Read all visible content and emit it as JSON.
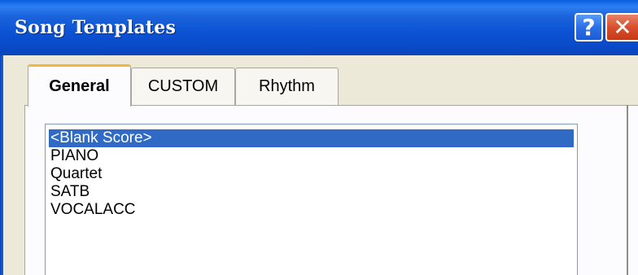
{
  "window": {
    "title": "Song Templates",
    "help_label": "?",
    "close_label": "✕"
  },
  "tabs": [
    {
      "label": "General",
      "selected": true
    },
    {
      "label": "CUSTOM",
      "selected": false
    },
    {
      "label": "Rhythm",
      "selected": false
    }
  ],
  "template_list": {
    "items": [
      {
        "label": "<Blank Score>",
        "selected": true
      },
      {
        "label": "PIANO",
        "selected": false
      },
      {
        "label": "Quartet",
        "selected": false
      },
      {
        "label": "SATB",
        "selected": false
      },
      {
        "label": "VOCALACC",
        "selected": false
      }
    ]
  },
  "colors": {
    "titlebar": "#0a4ac8",
    "selection": "#316ac5",
    "tab_highlight": "#f5b43a",
    "close_button": "#d9502e"
  }
}
